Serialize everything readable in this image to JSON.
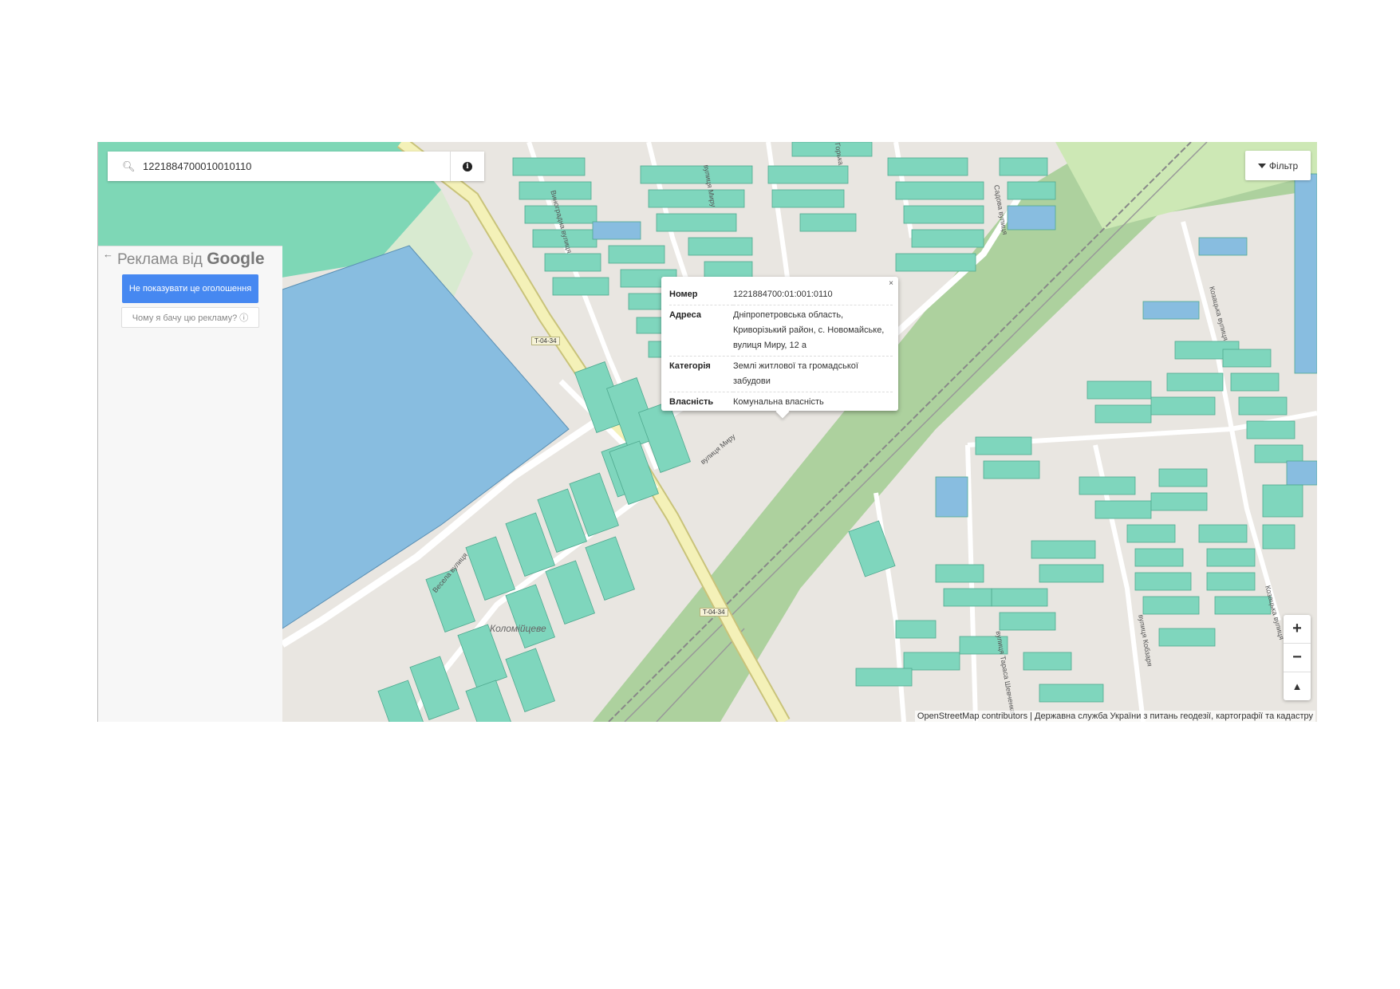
{
  "search": {
    "value": "1221884700010010110"
  },
  "filter_button": {
    "label": "Фільтр"
  },
  "ad": {
    "title_prefix": "Реклама від",
    "title_brand": "Google",
    "hide_button": "Не показувати це оголошення",
    "why_button": "Чому я бачу цю рекламу? ⓘ"
  },
  "popup": {
    "rows": [
      {
        "key": "Номер",
        "value": "1221884700:01:001:0110"
      },
      {
        "key": "Адреса",
        "value": "Дніпропетровська область, Криворізький район, с. Новомайське, вулиця Миру, 12 а"
      },
      {
        "key": "Категорія",
        "value": "Землі житлової та громадської забудови"
      },
      {
        "key": "Власність",
        "value": "Комунальна власність"
      }
    ],
    "close": "×"
  },
  "map_labels": {
    "road_1": "T-04-34",
    "road_2": "T-04-34",
    "street_myru": "вулиця Миру",
    "street_myru_2": "вулиця Миру",
    "street_vynohradna": "Виноградна вулиця",
    "street_vesela": "Весела вулиця",
    "street_kozatska": "Козацька вулиця",
    "street_kozatska_2": "Козацька вулиця",
    "street_kobzarya": "вулиця Кобзаря",
    "street_tarasa": "вулиця Тараса Шевченка",
    "street_sadova": "Садова вулиця",
    "street_gorky": "Горька",
    "place": "Коломійцеве"
  },
  "zoom": {
    "in": "+",
    "out": "−",
    "reset": "▲"
  },
  "attribution": "OpenStreetMap contributors | Державна служба України з питань геодезії, картографії та кадастру",
  "colors": {
    "parcel": "#7fd6bd",
    "parcel_blue": "#88bde0",
    "road_main": "#f4f1b8",
    "green": "#add19e",
    "water": "#7ed7b6"
  }
}
